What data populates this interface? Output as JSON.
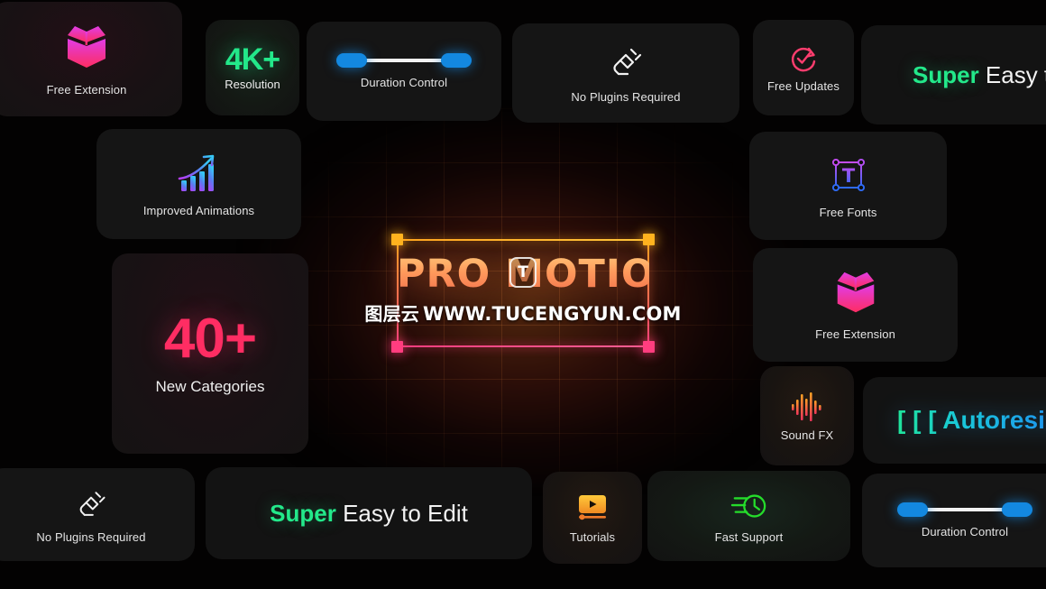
{
  "scene": {
    "center_title": "PRO MOTION",
    "text_tool_glyph": "T",
    "watermark_cn": "图层云",
    "watermark_url": "WWW.TUCENGYUN.COM"
  },
  "colors": {
    "accent_green": "#23E88A",
    "accent_pink": "#FF2D63",
    "accent_blue": "#1388E0",
    "accent_cyan": "#19C8D8",
    "accent_orange": "#FFB41E",
    "card_bg": "#161616",
    "page_bg": "#030202"
  },
  "cards": [
    {
      "id": "free-extension-top",
      "label": "Free Extension",
      "icon": "open-box-icon"
    },
    {
      "id": "resolution",
      "label": "Resolution",
      "value": "4K+",
      "icon": "none"
    },
    {
      "id": "duration-control-top",
      "label": "Duration Control",
      "icon": "duration-slider-icon"
    },
    {
      "id": "no-plugins-top",
      "label": "No Plugins Required",
      "icon": "plug-icon"
    },
    {
      "id": "free-updates",
      "label": "Free Updates",
      "icon": "refresh-check-icon"
    },
    {
      "id": "super-easy-top",
      "label_highlight": "Super",
      "label_rest": " Easy to Edit",
      "icon": "none"
    },
    {
      "id": "improved-animations",
      "label": "Improved Animations",
      "icon": "growth-chart-icon"
    },
    {
      "id": "free-fonts",
      "label": "Free Fonts",
      "icon": "text-box-icon"
    },
    {
      "id": "new-categories",
      "label": "New Categories",
      "value": "40+",
      "icon": "none"
    },
    {
      "id": "free-extension-right",
      "label": "Free Extension",
      "icon": "open-box-icon"
    },
    {
      "id": "sound-fx",
      "label": "Sound FX",
      "icon": "waveform-icon"
    },
    {
      "id": "autoresize",
      "label": "[ [ [ Autoresize",
      "icon": "none"
    },
    {
      "id": "no-plugins-bottom",
      "label": "No Plugins Required",
      "icon": "plug-icon"
    },
    {
      "id": "super-easy-bottom",
      "label_highlight": "Super",
      "label_rest": " Easy to Edit",
      "icon": "none"
    },
    {
      "id": "tutorials",
      "label": "Tutorials",
      "icon": "video-play-icon"
    },
    {
      "id": "fast-support",
      "label": "Fast Support",
      "icon": "fast-clock-icon"
    },
    {
      "id": "duration-control-bottom",
      "label": "Duration Control",
      "icon": "duration-slider-icon"
    }
  ]
}
